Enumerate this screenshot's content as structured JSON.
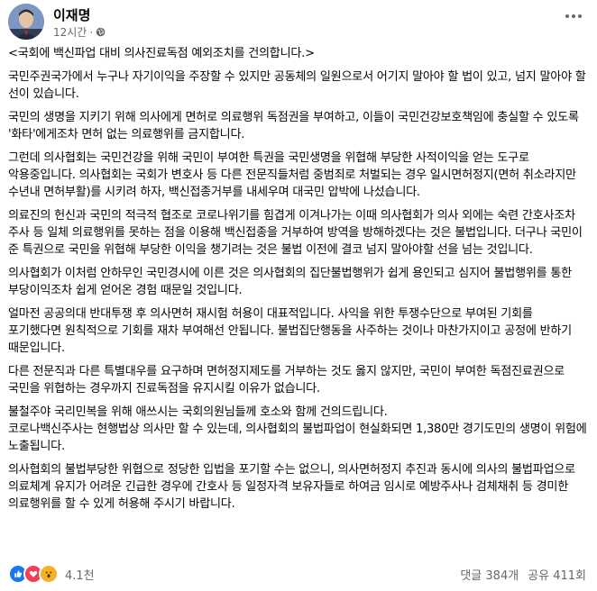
{
  "header": {
    "author": "이재명",
    "time": "12시간",
    "privacy_icon": "globe-icon",
    "more_icon": "more-icon"
  },
  "post": {
    "paragraphs": [
      "<국회에 백신파업 대비 의사진료독점 예외조치를 건의합니다.>",
      "국민주권국가에서 누구나 자기이익을 주장할 수 있지만 공동체의 일원으로서 어기지 말아야 할 법이 있고, 넘지 말아야 할 선이 있습니다.",
      "국민의 생명을 지키기 위해 의사에게 면허로 의료행위 독점권을 부여하고, 이들이 국민건강보호책임에 충실할 수 있도록 '화타'에게조차 면허 없는 의료행위를 금지합니다.",
      "그런데 의사협회는 국민건강을 위해 국민이 부여한 특권을 국민생명을 위협해 부당한 사적이익을 얻는 도구로 악용중입니다. 의사협회는 국회가 변호사 등 다른 전문직들처럼 중범죄로 처벌되는 경우 일시면허정지(면허 취소라지만 수년내 면허부활)를 시키려 하자, 백신접종거부를 내세우며 대국민 압박에 나섰습니다.",
      "의료진의 헌신과 국민의 적극적 협조로 코로나위기를 힘겹게 이겨나가는 이때 의사협회가 의사 외에는 숙련 간호사조차 주사 등 일체 의료행위를 못하는 점을 이용해 백신접종을 거부하여 방역을 방해하겠다는 것은 불법입니다. 더구나 국민이 준 특권으로 국민을 위협해 부당한 이익을 챙기려는 것은 불법 이전에 결코 넘지 말아야할 선을 넘는 것입니다.",
      "의사협회가 이처럼 안하무인 국민경시에 이른 것은 의사협회의 집단불법행위가 쉽게 용인되고 심지어 불법행위를 통한 부당이익조차 쉽게 얻어온 경험 때문일 것입니다.",
      "얼마전 공공의대 반대투쟁 후 의사면허 재시험 허용이 대표적입니다. 사익을 위한 투쟁수단으로 부여된 기회를 포기했다면 원칙적으로 기회를 재차 부여해선 안됩니다. 불법집단행동을 사주하는 것이나 마찬가지이고 공정에 반하기 때문입니다.",
      "다른 전문직과 다른 특별대우를 요구하며 면허정지제도를 거부하는 것도 옳지 않지만, 국민이 부여한 독점진료권으로 국민을 위협하는 경우까지 진료독점을 유지시킬 이유가 없습니다.",
      "불철주야 국리민복을 위해 애쓰시는 국회의원님들께 호소와 함께 건의드립니다.",
      "코로나백신주사는 현행법상 의사만 할 수 있는데, 의사협회의 불법파업이 현실화되면 1,380만 경기도민의 생명이 위험에 노출됩니다.",
      "의사협회의 불법부당한 위협으로 정당한 입법을 포기할 수는 없으니, 의사면허정지 추진과 동시에 의사의 불법파업으로 의료체계 유지가 어려운 긴급한 경우에 간호사 등 일정자격 보유자들로 하여금 임시로 예방주사나 검체채취 등 경미한 의료행위를 할 수 있게 허용해 주시기 바랍니다."
    ]
  },
  "footer": {
    "reaction_count": "4.1천",
    "reaction_icons": [
      "like-icon",
      "love-icon",
      "wow-icon"
    ],
    "comments": "댓글 384개",
    "shares": "공유 411회"
  },
  "colors": {
    "text": "#050505",
    "meta": "#65676b",
    "like": "#1877f2",
    "love": "#f33e58",
    "wow": "#f7b125"
  }
}
